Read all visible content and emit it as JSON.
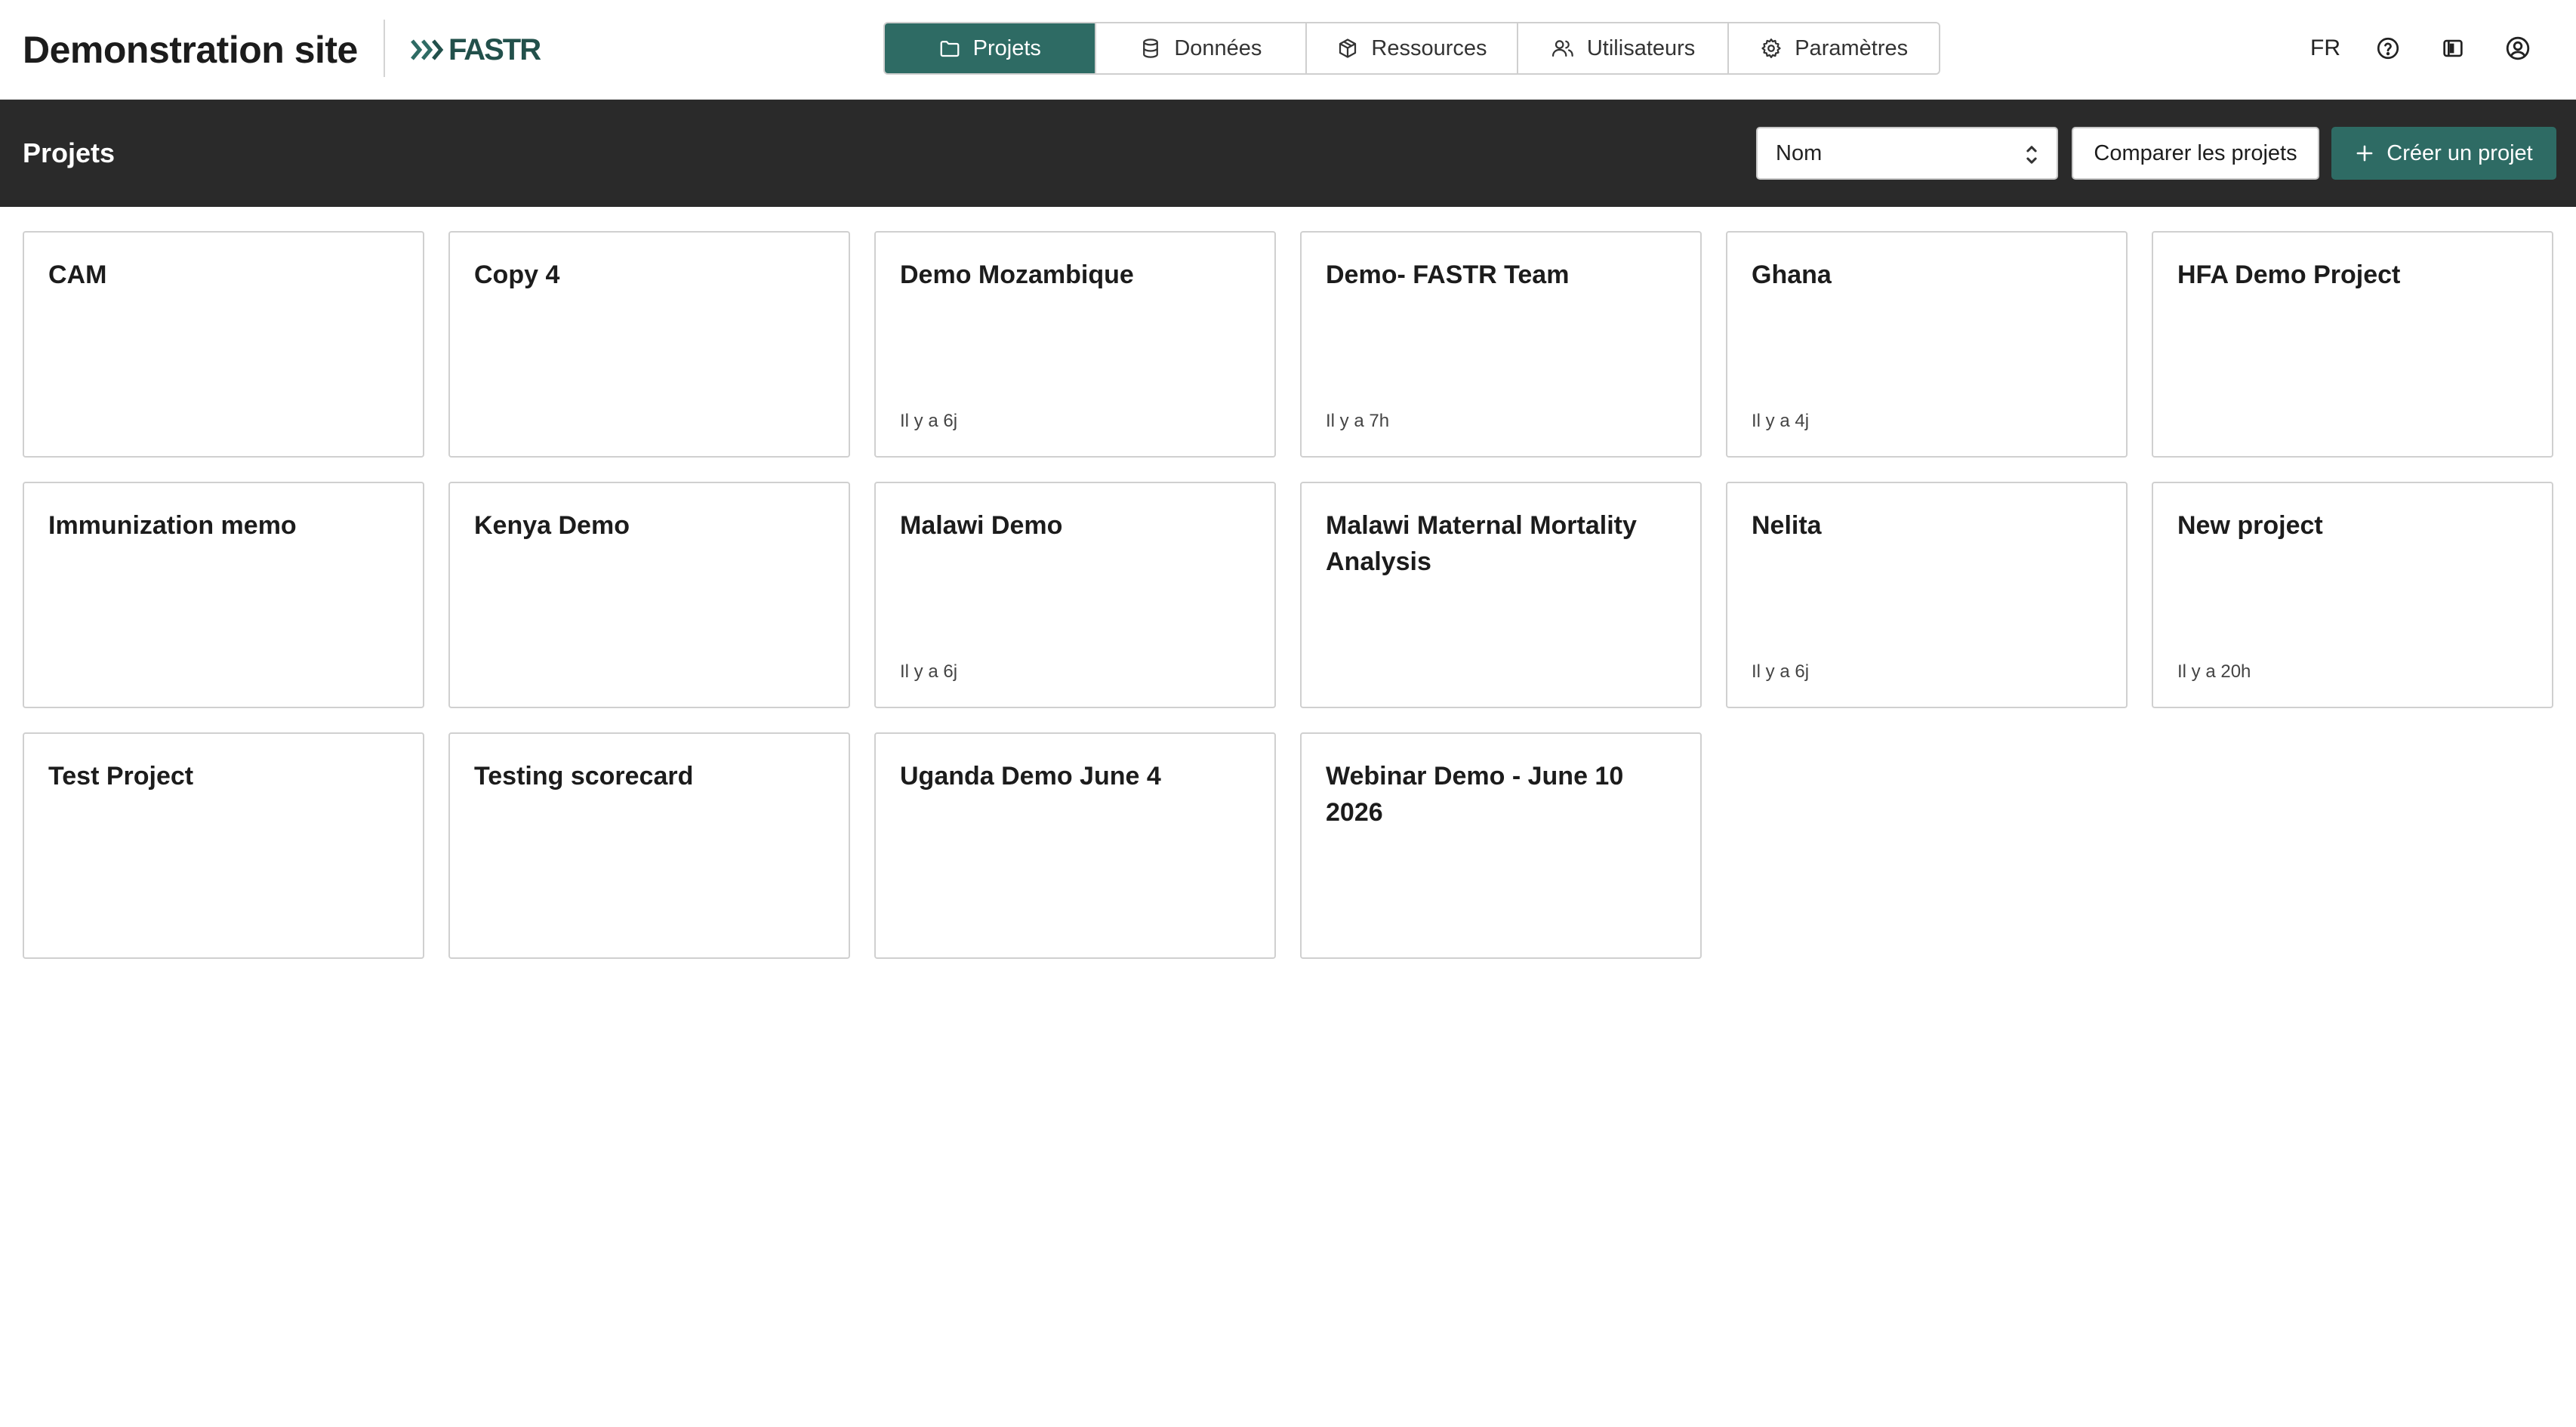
{
  "header": {
    "site_title": "Demonstration site",
    "brand_text": "FASTR",
    "brand_color": "#22504b",
    "nav": [
      {
        "label": "Projets",
        "icon": "folder-icon",
        "active": true
      },
      {
        "label": "Données",
        "icon": "database-icon",
        "active": false
      },
      {
        "label": "Ressources",
        "icon": "box-icon",
        "active": false
      },
      {
        "label": "Utilisateurs",
        "icon": "users-icon",
        "active": false
      },
      {
        "label": "Paramètres",
        "icon": "gear-icon",
        "active": false
      }
    ],
    "language": "FR",
    "right_icons": [
      "help-icon",
      "panel-toggle-icon",
      "account-icon"
    ]
  },
  "toolbar": {
    "title": "Projets",
    "sort_value": "Nom",
    "compare_label": "Comparer les projets",
    "create_label": "Créer un projet"
  },
  "colors": {
    "accent": "#2e6b64",
    "dark_bar": "#2a2a2a"
  },
  "projects": [
    {
      "name": "CAM",
      "time": ""
    },
    {
      "name": "Copy 4",
      "time": ""
    },
    {
      "name": "Demo Mozambique",
      "time": "Il y a 6j"
    },
    {
      "name": "Demo- FASTR Team",
      "time": "Il y a 7h"
    },
    {
      "name": "Ghana",
      "time": "Il y a 4j"
    },
    {
      "name": "HFA Demo Project",
      "time": ""
    },
    {
      "name": "Immunization memo",
      "time": ""
    },
    {
      "name": "Kenya Demo",
      "time": ""
    },
    {
      "name": "Malawi Demo",
      "time": "Il y a 6j"
    },
    {
      "name": "Malawi Maternal Mortality Analysis",
      "time": ""
    },
    {
      "name": "Nelita",
      "time": "Il y a 6j"
    },
    {
      "name": "New project",
      "time": "Il y a 20h"
    },
    {
      "name": "Test Project",
      "time": ""
    },
    {
      "name": "Testing scorecard",
      "time": ""
    },
    {
      "name": "Uganda Demo June 4",
      "time": ""
    },
    {
      "name": "Webinar Demo - June 10 2026",
      "time": ""
    }
  ]
}
